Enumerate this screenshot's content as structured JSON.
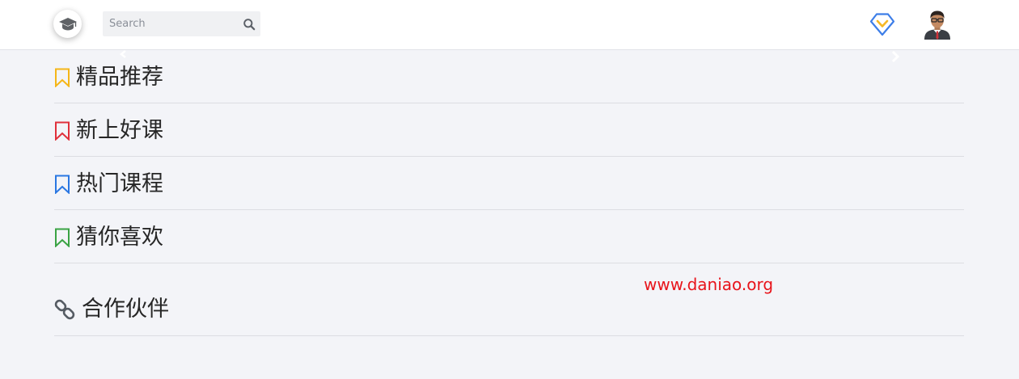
{
  "header": {
    "logo_icon": "graduation-cap-icon",
    "search": {
      "placeholder": "Search",
      "value": ""
    },
    "vip_icon": "diamond-icon",
    "avatar_icon": "user-avatar-icon"
  },
  "sections": [
    {
      "title": "精品推荐",
      "icon": "bookmark-icon",
      "color": "#f5b618"
    },
    {
      "title": "新上好课",
      "icon": "bookmark-icon",
      "color": "#e0303b"
    },
    {
      "title": "热门课程",
      "icon": "bookmark-icon",
      "color": "#2a77e2"
    },
    {
      "title": "猜你喜欢",
      "icon": "bookmark-icon",
      "color": "#3aa344"
    },
    {
      "title": "合作伙伴",
      "icon": "link-icon",
      "color": "#555b63"
    }
  ],
  "watermark": "www.daniao.org",
  "colors": {
    "background": "#f3f4f8",
    "header": "#ffffff",
    "vip_blue": "#3d7ee8",
    "vip_yellow": "#f6b824"
  }
}
